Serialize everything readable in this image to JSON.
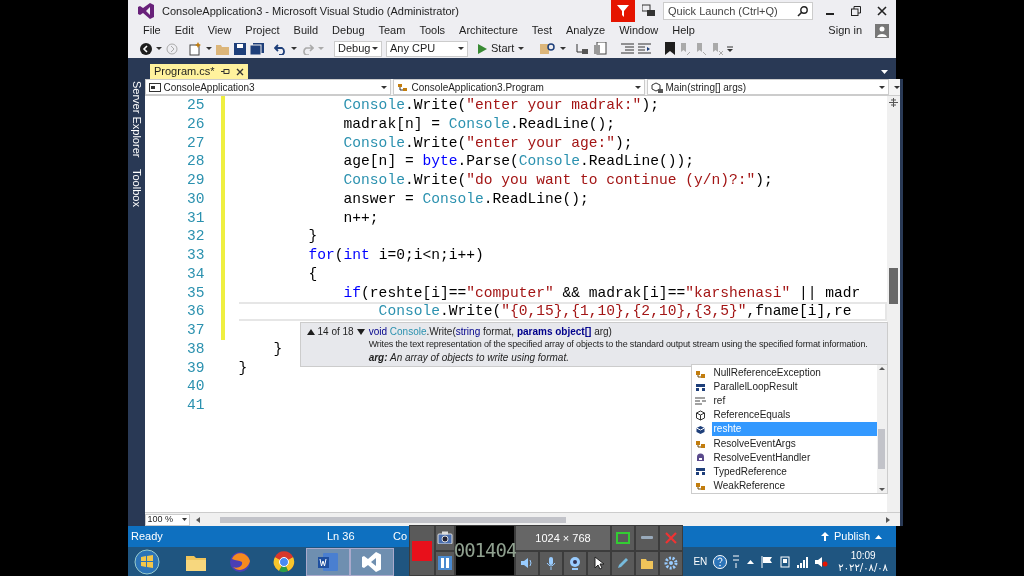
{
  "window": {
    "title": "ConsoleApplication3 - Microsoft Visual Studio (Administrator)"
  },
  "quick_launch": {
    "placeholder": "Quick Launch (Ctrl+Q)"
  },
  "menu": [
    "File",
    "Edit",
    "View",
    "Project",
    "Build",
    "Debug",
    "Team",
    "Tools",
    "Architecture",
    "Test",
    "Analyze",
    "Window",
    "Help"
  ],
  "sign_in": "Sign in",
  "toolbar": {
    "configuration": "Debug",
    "platform": "Any CPU",
    "start": "Start"
  },
  "side_tabs": [
    "Server Explorer",
    "Toolbox"
  ],
  "tabs": [
    {
      "label": "Program.cs*",
      "selected": true
    }
  ],
  "navigation": [
    "ConsoleApplication3",
    "ConsoleApplication3.Program",
    "Main(string[] args)"
  ],
  "editor": {
    "lines": [
      {
        "number": "25",
        "changed": true,
        "current": false,
        "tokens": [
          {
            "kind": "type",
            "text": "            Console"
          },
          {
            "kind": "plain",
            "text": ".Write("
          },
          {
            "kind": "string",
            "text": "\"enter your madrak:\""
          },
          {
            "kind": "plain",
            "text": ");"
          }
        ]
      },
      {
        "number": "26",
        "changed": true,
        "current": false,
        "tokens": [
          {
            "kind": "plain",
            "text": "            madrak[n] = "
          },
          {
            "kind": "type",
            "text": "Console"
          },
          {
            "kind": "plain",
            "text": ".ReadLine();"
          }
        ]
      },
      {
        "number": "27",
        "changed": true,
        "current": false,
        "tokens": [
          {
            "kind": "type",
            "text": "            Console"
          },
          {
            "kind": "plain",
            "text": ".Write("
          },
          {
            "kind": "string",
            "text": "\"enter your age:\""
          },
          {
            "kind": "plain",
            "text": ");"
          }
        ]
      },
      {
        "number": "28",
        "changed": true,
        "current": false,
        "tokens": [
          {
            "kind": "plain",
            "text": "            age[n] = "
          },
          {
            "kind": "keyword",
            "text": "byte"
          },
          {
            "kind": "plain",
            "text": ".Parse("
          },
          {
            "kind": "type",
            "text": "Console"
          },
          {
            "kind": "plain",
            "text": ".ReadLine());"
          }
        ]
      },
      {
        "number": "29",
        "changed": true,
        "current": false,
        "tokens": [
          {
            "kind": "type",
            "text": "            Console"
          },
          {
            "kind": "plain",
            "text": ".Write("
          },
          {
            "kind": "string",
            "text": "\"do you want to continue (y/n)?:\""
          },
          {
            "kind": "plain",
            "text": ");"
          }
        ]
      },
      {
        "number": "30",
        "changed": true,
        "current": false,
        "tokens": [
          {
            "kind": "plain",
            "text": "            answer = "
          },
          {
            "kind": "type",
            "text": "Console"
          },
          {
            "kind": "plain",
            "text": ".ReadLine();"
          }
        ]
      },
      {
        "number": "31",
        "changed": true,
        "current": false,
        "tokens": [
          {
            "kind": "plain",
            "text": "            n++;"
          }
        ]
      },
      {
        "number": "32",
        "changed": true,
        "current": false,
        "tokens": [
          {
            "kind": "plain",
            "text": "        }"
          }
        ]
      },
      {
        "number": "33",
        "changed": true,
        "current": false,
        "tokens": [
          {
            "kind": "keyword",
            "text": "        for"
          },
          {
            "kind": "plain",
            "text": "("
          },
          {
            "kind": "keyword",
            "text": "int"
          },
          {
            "kind": "plain",
            "text": " i=0;i<n;i++)"
          }
        ]
      },
      {
        "number": "34",
        "changed": true,
        "current": false,
        "tokens": [
          {
            "kind": "plain",
            "text": "        {"
          }
        ]
      },
      {
        "number": "35",
        "changed": true,
        "current": false,
        "tokens": [
          {
            "kind": "keyword",
            "text": "            if"
          },
          {
            "kind": "plain",
            "text": "(reshte[i]=="
          },
          {
            "kind": "string",
            "text": "\"computer\""
          },
          {
            "kind": "plain",
            "text": " && madrak[i]=="
          },
          {
            "kind": "string",
            "text": "\"karshenasi\""
          },
          {
            "kind": "plain",
            "text": " || madr"
          }
        ]
      },
      {
        "number": "36",
        "changed": true,
        "current": true,
        "tokens": [
          {
            "kind": "type",
            "text": "                Console"
          },
          {
            "kind": "plain",
            "text": ".Write("
          },
          {
            "kind": "string",
            "text": "\"{0,15},{1,10},{2,10},{3,5}\""
          },
          {
            "kind": "plain",
            "text": ",fname[i],re"
          }
        ]
      },
      {
        "number": "37",
        "changed": true,
        "current": false
      },
      {
        "number": "38",
        "changed": false,
        "current": false,
        "tokens": [
          {
            "kind": "plain",
            "text": "    }"
          }
        ]
      },
      {
        "number": "39",
        "changed": false,
        "current": false,
        "tokens": [
          {
            "kind": "plain",
            "text": "}"
          }
        ]
      },
      {
        "number": "40",
        "changed": false,
        "current": false
      },
      {
        "number": "41",
        "changed": false,
        "current": false
      }
    ]
  },
  "tooltip": {
    "counter": "14 of 18",
    "signature": [
      {
        "kind": "keyword",
        "text": "void "
      },
      {
        "kind": "type",
        "text": "Console"
      },
      {
        "kind": "plain",
        "text": ".Write("
      },
      {
        "kind": "keyword",
        "text": "string"
      },
      {
        "kind": "plain",
        "text": " format, "
      },
      {
        "kind": "bold",
        "text": "params object[]"
      },
      {
        "kind": "plain",
        "text": " arg)"
      }
    ],
    "description": "Writes the text representation of the specified array of objects to the standard output stream using the specified format information.",
    "parameter": "**arg:** An array of objects to write using format."
  },
  "completion": [
    {
      "label": "NullReferenceException",
      "kind": "class",
      "selected": false
    },
    {
      "label": "ParallelLoopResult",
      "kind": "struct",
      "selected": false
    },
    {
      "label": "ref",
      "kind": "keyword",
      "selected": false
    },
    {
      "label": "ReferenceEquals",
      "kind": "method",
      "selected": false
    },
    {
      "label": "reshte",
      "kind": "local",
      "selected": true
    },
    {
      "label": "ResolveEventArgs",
      "kind": "class",
      "selected": false
    },
    {
      "label": "ResolveEventHandler",
      "kind": "delegate",
      "selected": false
    },
    {
      "label": "TypedReference",
      "kind": "struct",
      "selected": false
    },
    {
      "label": "WeakReference",
      "kind": "class",
      "selected": false
    }
  ],
  "zoom": "100 %",
  "status_bar": {
    "state": "Ready",
    "line": "Ln 36",
    "column": "Co",
    "publish": "Publish"
  },
  "recorder": {
    "timer": "001404",
    "resolution": "1024 × 768"
  },
  "taskbar": {
    "language": "EN",
    "time": "10:09",
    "date": "۲۰۲۲/۰۸/۰۸"
  }
}
